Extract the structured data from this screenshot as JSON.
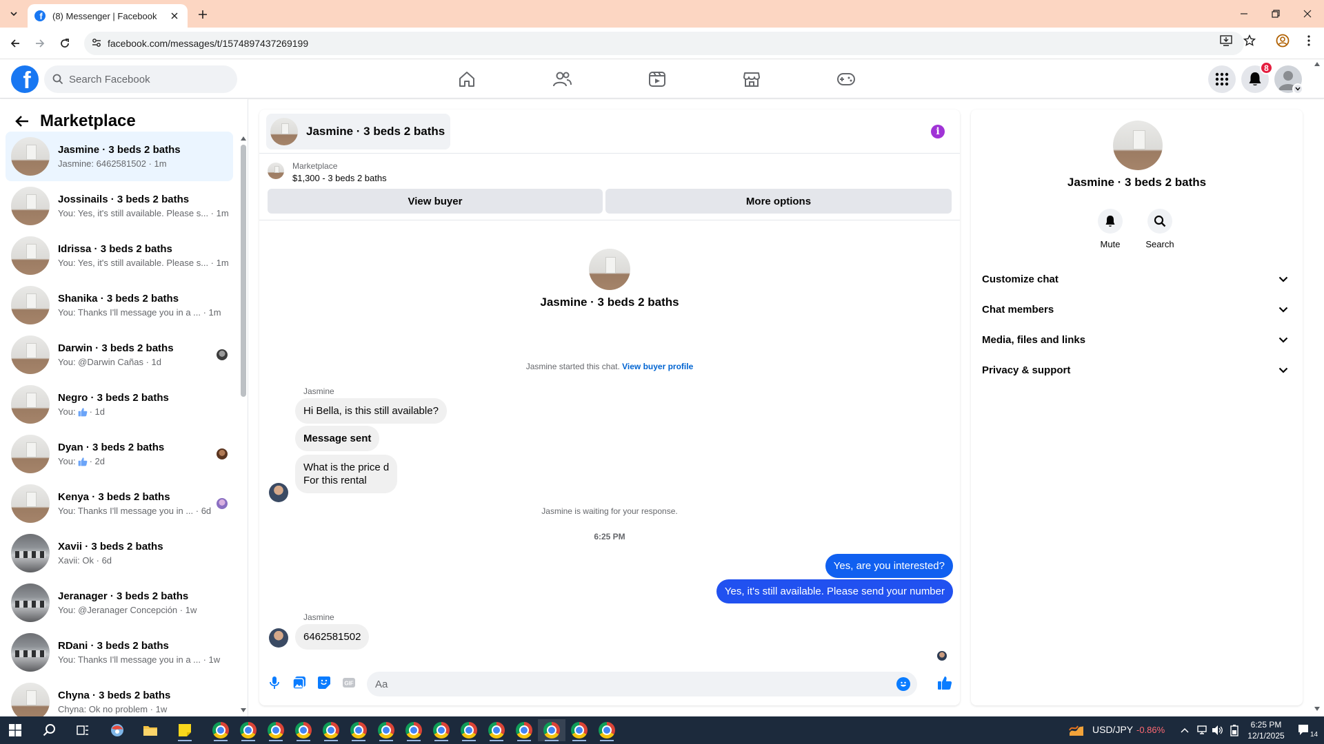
{
  "browser": {
    "tab_title": "(8) Messenger | Facebook",
    "url": "facebook.com/messages/t/1574897437269199"
  },
  "facebook": {
    "search_placeholder": "Search Facebook",
    "notification_count": "8",
    "brand_color": "#1877f2"
  },
  "sidebar": {
    "title": "Marketplace",
    "conversations": [
      {
        "name": "Jasmine · 3 beds 2 baths",
        "preview": "Jasmine: 6462581502 · 1m",
        "avatar": "room",
        "active": true
      },
      {
        "name": "Jossinails · 3 beds 2 baths",
        "preview": "You: Yes, it's still available. Please s... · 1m",
        "avatar": "room"
      },
      {
        "name": "Idrissa · 3 beds 2 baths",
        "preview": "You: Yes, it's still available. Please s... · 1m",
        "avatar": "room"
      },
      {
        "name": "Shanika · 3 beds 2 baths",
        "preview": "You: Thanks I'll message you in a ... · 1m",
        "avatar": "room"
      },
      {
        "name": "Darwin · 3 beds 2 baths",
        "preview": "You: @Darwin Cañas · 1d",
        "avatar": "room",
        "receipt": true
      },
      {
        "name": "Negro · 3 beds 2 baths",
        "preview_prefix": "You:",
        "preview_suffix": "· 1d",
        "preview_icon": "like-icon",
        "avatar": "room"
      },
      {
        "name": "Dyan · 3 beds 2 baths",
        "preview_prefix": "You:",
        "preview_suffix": "· 2d",
        "preview_icon": "like-icon",
        "avatar": "room",
        "receipt": true
      },
      {
        "name": "Kenya · 3 beds 2 baths",
        "preview": "You: Thanks I'll message you in ... · 6d",
        "avatar": "room",
        "receipt": true
      },
      {
        "name": "Xavii · 3 beds 2 baths",
        "preview": "Xavii: Ok · 6d",
        "avatar": "office"
      },
      {
        "name": "Jeranager · 3 beds 2 baths",
        "preview": "You: @Jeranager Concepción · 1w",
        "avatar": "office"
      },
      {
        "name": "RDani · 3 beds 2 baths",
        "preview": "You: Thanks I'll message you in a ... · 1w",
        "avatar": "office"
      },
      {
        "name": "Chyna · 3 beds 2 baths",
        "preview": "Chyna: Ok no problem · 1w",
        "avatar": "room"
      }
    ]
  },
  "chat": {
    "header_title": "Jasmine · 3 beds 2 baths",
    "marketplace_label": "Marketplace",
    "listing": "$1,300 - 3 beds 2 baths",
    "view_buyer_label": "View buyer",
    "more_options_label": "More options",
    "intro_name": "Jasmine · 3 beds 2 baths",
    "started_note": "Jasmine started this chat.",
    "view_buyer_profile": "View buyer profile",
    "sender_name_1": "Jasmine",
    "msg_1": "Hi Bella, is this still available?",
    "msg_2": "Message sent",
    "msg_3_line1": "What is the price d",
    "msg_3_line2": "For this rental",
    "waiting_note": "Jasmine is waiting for your response.",
    "timestamp": "6:25 PM",
    "out_1": "Yes, are you interested?",
    "out_2": "Yes, it's still available. Please send your number",
    "sender_name_2": "Jasmine",
    "msg_4": "6462581502",
    "composer_placeholder": "Aa",
    "outgoing_color": "#0a7cff"
  },
  "details": {
    "name": "Jasmine · 3 beds 2 baths",
    "mute_label": "Mute",
    "search_label": "Search",
    "sections": [
      "Customize chat",
      "Chat members",
      "Media, files and links",
      "Privacy & support"
    ]
  },
  "taskbar": {
    "ticker_symbol": "USD/JPY",
    "ticker_change": "-0.86%",
    "time": "6:25 PM",
    "date": "12/1/2025",
    "notification_count": "14"
  }
}
